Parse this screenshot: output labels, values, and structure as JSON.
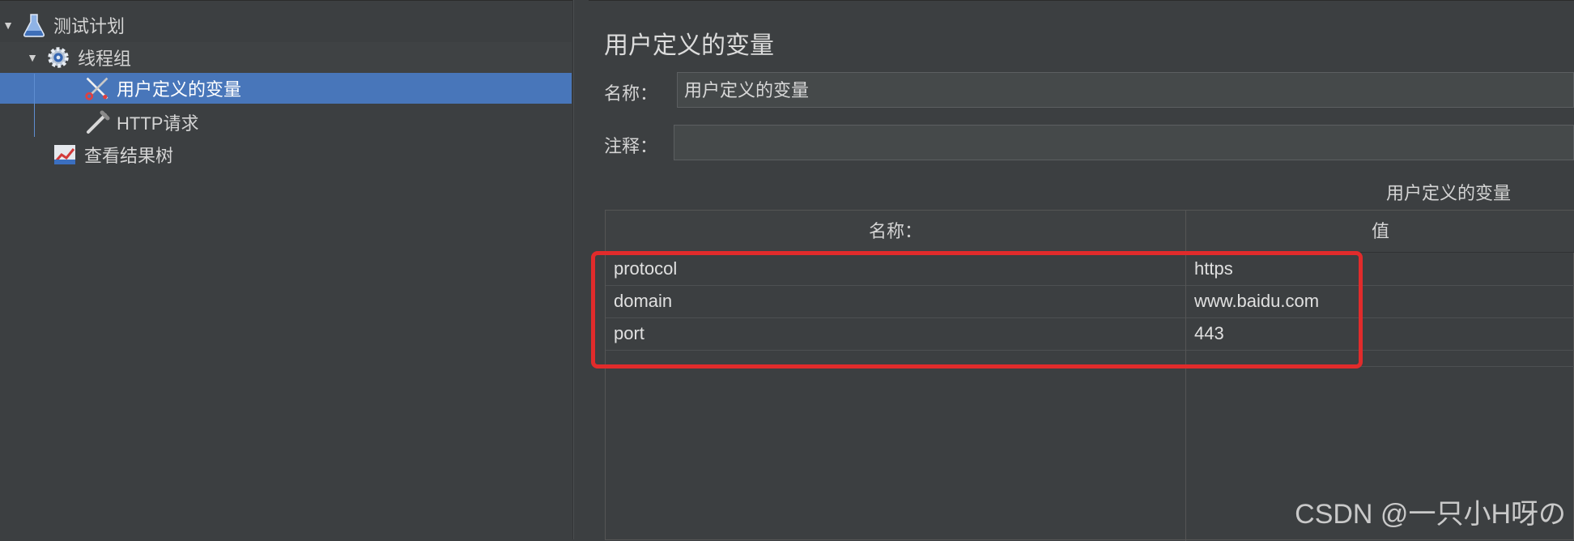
{
  "tree": {
    "items": [
      {
        "label": "测试计划",
        "icon": "flask-icon",
        "expanded": true
      },
      {
        "label": "线程组",
        "icon": "gear-icon",
        "expanded": true
      },
      {
        "label": "用户定义的变量",
        "icon": "scissors-icon",
        "selected": true
      },
      {
        "label": "HTTP请求",
        "icon": "pipette-icon"
      },
      {
        "label": "查看结果树",
        "icon": "chart-icon"
      }
    ]
  },
  "detail": {
    "title": "用户定义的变量",
    "name_label": "名称：",
    "name_value": "用户定义的变量",
    "comment_label": "注释：",
    "comment_value": "",
    "table_caption": "用户定义的变量",
    "table": {
      "headers": [
        "名称：",
        "值"
      ],
      "rows": [
        {
          "name": "protocol",
          "value": "https"
        },
        {
          "name": "domain",
          "value": "www.baidu.com"
        },
        {
          "name": "port",
          "value": "443"
        }
      ]
    }
  },
  "watermark": "CSDN @一只小H呀の",
  "colors": {
    "background": "#3c3f41",
    "selection": "#4876ba",
    "highlight_border": "#e12b2b"
  }
}
